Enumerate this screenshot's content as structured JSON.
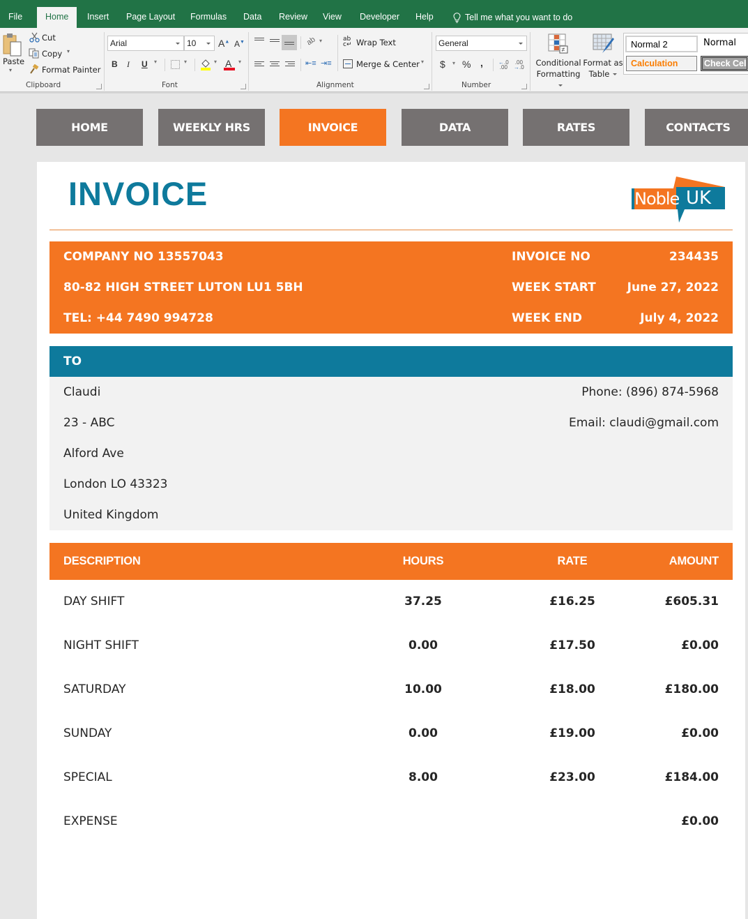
{
  "ribbon": {
    "tabs": [
      {
        "label": "File",
        "active": false
      },
      {
        "label": "Home",
        "active": true
      },
      {
        "label": "Insert",
        "active": false
      },
      {
        "label": "Page Layout",
        "active": false
      },
      {
        "label": "Formulas",
        "active": false
      },
      {
        "label": "Data",
        "active": false
      },
      {
        "label": "Review",
        "active": false
      },
      {
        "label": "View",
        "active": false
      },
      {
        "label": "Developer",
        "active": false
      },
      {
        "label": "Help",
        "active": false
      }
    ],
    "tell_me": "Tell me what you want to do",
    "clipboard": {
      "group_label": "Clipboard",
      "paste": "Paste",
      "cut": "Cut",
      "copy": "Copy",
      "format_painter": "Format Painter"
    },
    "font": {
      "group_label": "Font",
      "font_name": "Arial",
      "font_size": "10",
      "bold": "B",
      "italic": "I",
      "underline": "U",
      "grow": "A",
      "shrink": "A",
      "font_color": "A"
    },
    "alignment": {
      "group_label": "Alignment",
      "wrap_text": "Wrap Text",
      "merge_center": "Merge & Center"
    },
    "number": {
      "group_label": "Number",
      "format": "General",
      "currency": "$",
      "percent": "%",
      "comma": ","
    },
    "styles": {
      "conditional_formatting": [
        "Conditional",
        "Formatting"
      ],
      "format_as_table": [
        "Format as",
        "Table"
      ],
      "cells": [
        {
          "label": "Normal 2"
        },
        {
          "label": "Normal"
        },
        {
          "label": "Calculation"
        },
        {
          "label": "Check Cell"
        }
      ]
    }
  },
  "nav": {
    "buttons": [
      {
        "label": "HOME",
        "active": false
      },
      {
        "label": "WEEKLY HRS",
        "active": false
      },
      {
        "label": "INVOICE",
        "active": true
      },
      {
        "label": "DATA",
        "active": false
      },
      {
        "label": "RATES",
        "active": false
      },
      {
        "label": "CONTACTS",
        "active": false
      }
    ]
  },
  "invoice": {
    "title": "INVOICE",
    "logo": {
      "left": "Noble",
      "right": "UK"
    },
    "company": {
      "company_no": "COMPANY NO 13557043",
      "address": "80-82 HIGH STREET LUTON LU1 5BH",
      "tel": "TEL: +44 7490 994728"
    },
    "meta": [
      {
        "label": "INVOICE NO",
        "value": "234435"
      },
      {
        "label": "WEEK START",
        "value": "June 27, 2022"
      },
      {
        "label": "WEEK END",
        "value": "July 4, 2022"
      }
    ],
    "to": {
      "heading": "TO",
      "lines": [
        "Claudi",
        "23 - ABC",
        "Alford Ave",
        "London LO 43323",
        "United Kingdom"
      ],
      "phone": "Phone: (896) 874-5968",
      "email": "Email: claudi@gmail.com"
    },
    "table": {
      "headers": {
        "description": "DESCRIPTION",
        "hours": "HOURS",
        "rate": "RATE",
        "amount": "AMOUNT"
      },
      "rows": [
        {
          "description": "DAY SHIFT",
          "hours": "37.25",
          "rate": "£16.25",
          "amount": "£605.31"
        },
        {
          "description": "NIGHT SHIFT",
          "hours": "0.00",
          "rate": "£17.50",
          "amount": "£0.00"
        },
        {
          "description": "SATURDAY",
          "hours": "10.00",
          "rate": "£18.00",
          "amount": "£180.00"
        },
        {
          "description": "SUNDAY",
          "hours": "0.00",
          "rate": "£19.00",
          "amount": "£0.00"
        },
        {
          "description": "SPECIAL",
          "hours": "8.00",
          "rate": "£23.00",
          "amount": "£184.00"
        },
        {
          "description": "EXPENSE",
          "hours": "",
          "rate": "",
          "amount": "£0.00"
        }
      ]
    }
  },
  "colors": {
    "excel_green": "#217346",
    "accent_orange": "#f47521",
    "accent_teal": "#0e7a9c",
    "nav_gray": "#757171",
    "panel_gray": "#f2f2f2"
  }
}
